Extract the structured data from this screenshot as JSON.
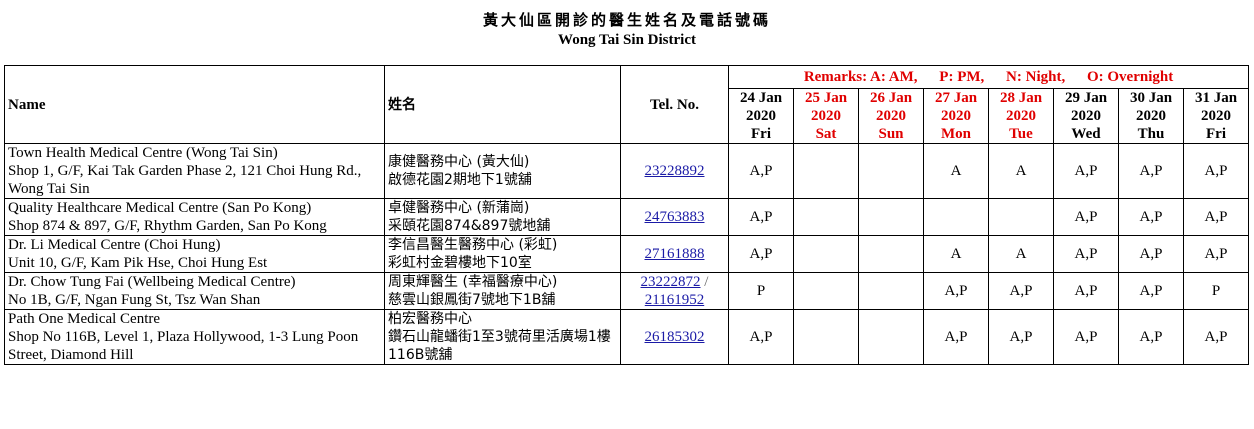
{
  "title_zh": "黃大仙區開診的醫生姓名及電話號碼",
  "title_en": "Wong Tai Sin District",
  "headers": {
    "name": "Name",
    "name_zh": "姓名",
    "tel": "Tel. No."
  },
  "remarks": [
    "Remarks: A: AM,",
    "P: PM,",
    "N: Night,",
    "O: Overnight"
  ],
  "dates": [
    {
      "d": "24 Jan",
      "y": "2020",
      "w": "Fri",
      "red": false
    },
    {
      "d": "25 Jan",
      "y": "2020",
      "w": "Sat",
      "red": true
    },
    {
      "d": "26 Jan",
      "y": "2020",
      "w": "Sun",
      "red": true
    },
    {
      "d": "27 Jan",
      "y": "2020",
      "w": "Mon",
      "red": true
    },
    {
      "d": "28 Jan",
      "y": "2020",
      "w": "Tue",
      "red": true
    },
    {
      "d": "29 Jan",
      "y": "2020",
      "w": "Wed",
      "red": false
    },
    {
      "d": "30 Jan",
      "y": "2020",
      "w": "Thu",
      "red": false
    },
    {
      "d": "31 Jan",
      "y": "2020",
      "w": "Fri",
      "red": false
    }
  ],
  "rows": [
    {
      "name": "Town Health Medical Centre (Wong Tai Sin)",
      "addr": "Shop 1, G/F, Kai Tak Garden Phase 2, 121 Choi Hung Rd., Wong Tai Sin",
      "name_zh": "康健醫務中心 (黃大仙)",
      "addr_zh": "啟德花園2期地下1號舖",
      "tel": [
        "23228892"
      ],
      "sched": [
        "A,P",
        "",
        "",
        "A",
        "A",
        "A,P",
        "A,P",
        "A,P"
      ]
    },
    {
      "name": "Quality Healthcare Medical Centre (San Po Kong)",
      "addr": "Shop 874 & 897, G/F, Rhythm Garden, San Po Kong",
      "name_zh": "卓健醫務中心 (新蒲崗)",
      "addr_zh": "采頤花園874&897號地舖",
      "tel": [
        "24763883"
      ],
      "sched": [
        "A,P",
        "",
        "",
        "",
        "",
        "A,P",
        "A,P",
        "A,P"
      ]
    },
    {
      "name": "Dr. Li Medical Centre (Choi Hung)",
      "addr": "Unit 10, G/F, Kam Pik Hse, Choi Hung Est",
      "name_zh": "李信昌醫生醫務中心 (彩虹)",
      "addr_zh": "彩虹村金碧樓地下10室",
      "tel": [
        "27161888"
      ],
      "sched": [
        "A,P",
        "",
        "",
        "A",
        "A",
        "A,P",
        "A,P",
        "A,P"
      ]
    },
    {
      "name": "Dr. Chow Tung Fai (Wellbeing Medical Centre)",
      "addr": "No 1B, G/F, Ngan Fung St, Tsz Wan Shan",
      "name_zh": "周東輝醫生 (幸福醫療中心)",
      "addr_zh": "慈雲山銀鳳街7號地下1B舖",
      "tel": [
        "23222872",
        "21161952"
      ],
      "sched": [
        "P",
        "",
        "",
        "A,P",
        "A,P",
        "A,P",
        "A,P",
        "P"
      ]
    },
    {
      "name": "Path One Medical Centre",
      "addr": "Shop No 116B, Level 1, Plaza Hollywood, 1-3 Lung Poon Street, Diamond Hill",
      "name_zh": "柏宏醫務中心",
      "addr_zh": "鑽石山龍蟠街1至3號荷里活廣場1樓116B號舖",
      "tel": [
        "26185302"
      ],
      "sched": [
        "A,P",
        "",
        "",
        "A,P",
        "A,P",
        "A,P",
        "A,P",
        "A,P"
      ]
    }
  ],
  "colors": {
    "remarks": "#e00000",
    "holiday": "#e00000",
    "link": "#1a1aa6"
  }
}
